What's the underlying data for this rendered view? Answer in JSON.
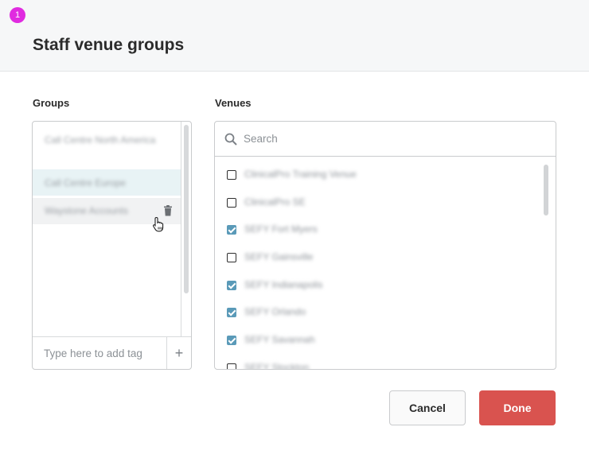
{
  "header": {
    "step_badge": "1",
    "title": "Staff venue groups"
  },
  "groups": {
    "label": "Groups",
    "items": [
      {
        "label": "Call Centre North America"
      },
      {
        "label": "Call Centre Europe"
      },
      {
        "label": "Waystone Accounts"
      }
    ],
    "tag_placeholder": "Type here to add tag",
    "add_symbol": "+"
  },
  "venues": {
    "label": "Venues",
    "search_placeholder": "Search",
    "items": [
      {
        "label": "ClinicalPro Training Venue",
        "checked": false
      },
      {
        "label": "ClinicalPro SE",
        "checked": false
      },
      {
        "label": "SEFY Fort Myers",
        "checked": true
      },
      {
        "label": "SEFY Gainsville",
        "checked": false
      },
      {
        "label": "SEFY Indianapolis",
        "checked": true
      },
      {
        "label": "SEFY Orlando",
        "checked": true
      },
      {
        "label": "SEFY Savannah",
        "checked": true
      },
      {
        "label": "SEFY Stockton",
        "checked": false
      }
    ]
  },
  "actions": {
    "cancel_label": "Cancel",
    "done_label": "Done"
  },
  "colors": {
    "accent_check": "#5a9ab8",
    "done_button": "#d9534f",
    "step_badge": "#e02be0"
  },
  "icons": [
    "search-icon",
    "trash-icon",
    "pointer-hand-icon",
    "plus-icon"
  ]
}
